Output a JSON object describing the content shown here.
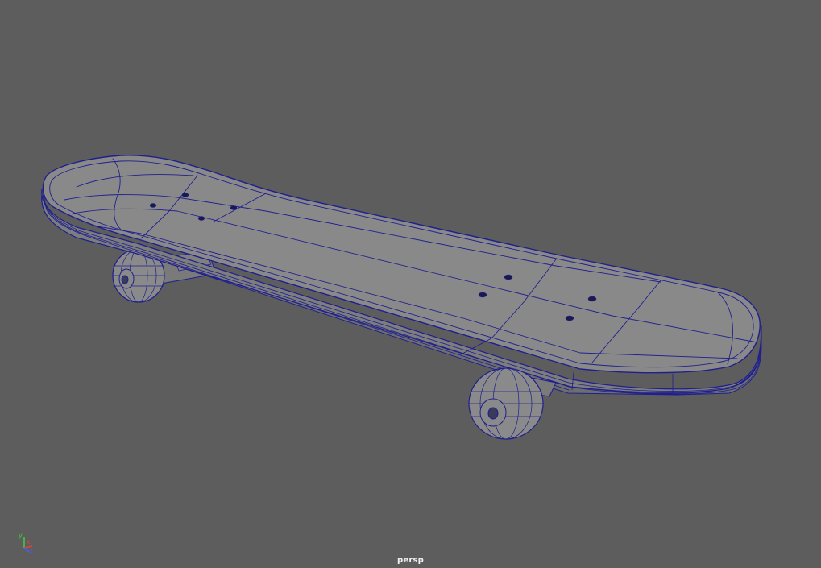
{
  "viewport": {
    "camera_name": "persp",
    "background_color": "#5d5d5d",
    "wireframe_color": "#1f1f8f",
    "surface_color": "#868686"
  },
  "model": {
    "object": "skateboard",
    "deck_bolt_holes": 8,
    "wheels_visible": 2
  },
  "axis_gizmo": {
    "x_label": "x",
    "y_label": "y",
    "z_label": "z",
    "x_color": "#e04040",
    "y_color": "#40d040",
    "z_color": "#4060ff"
  }
}
